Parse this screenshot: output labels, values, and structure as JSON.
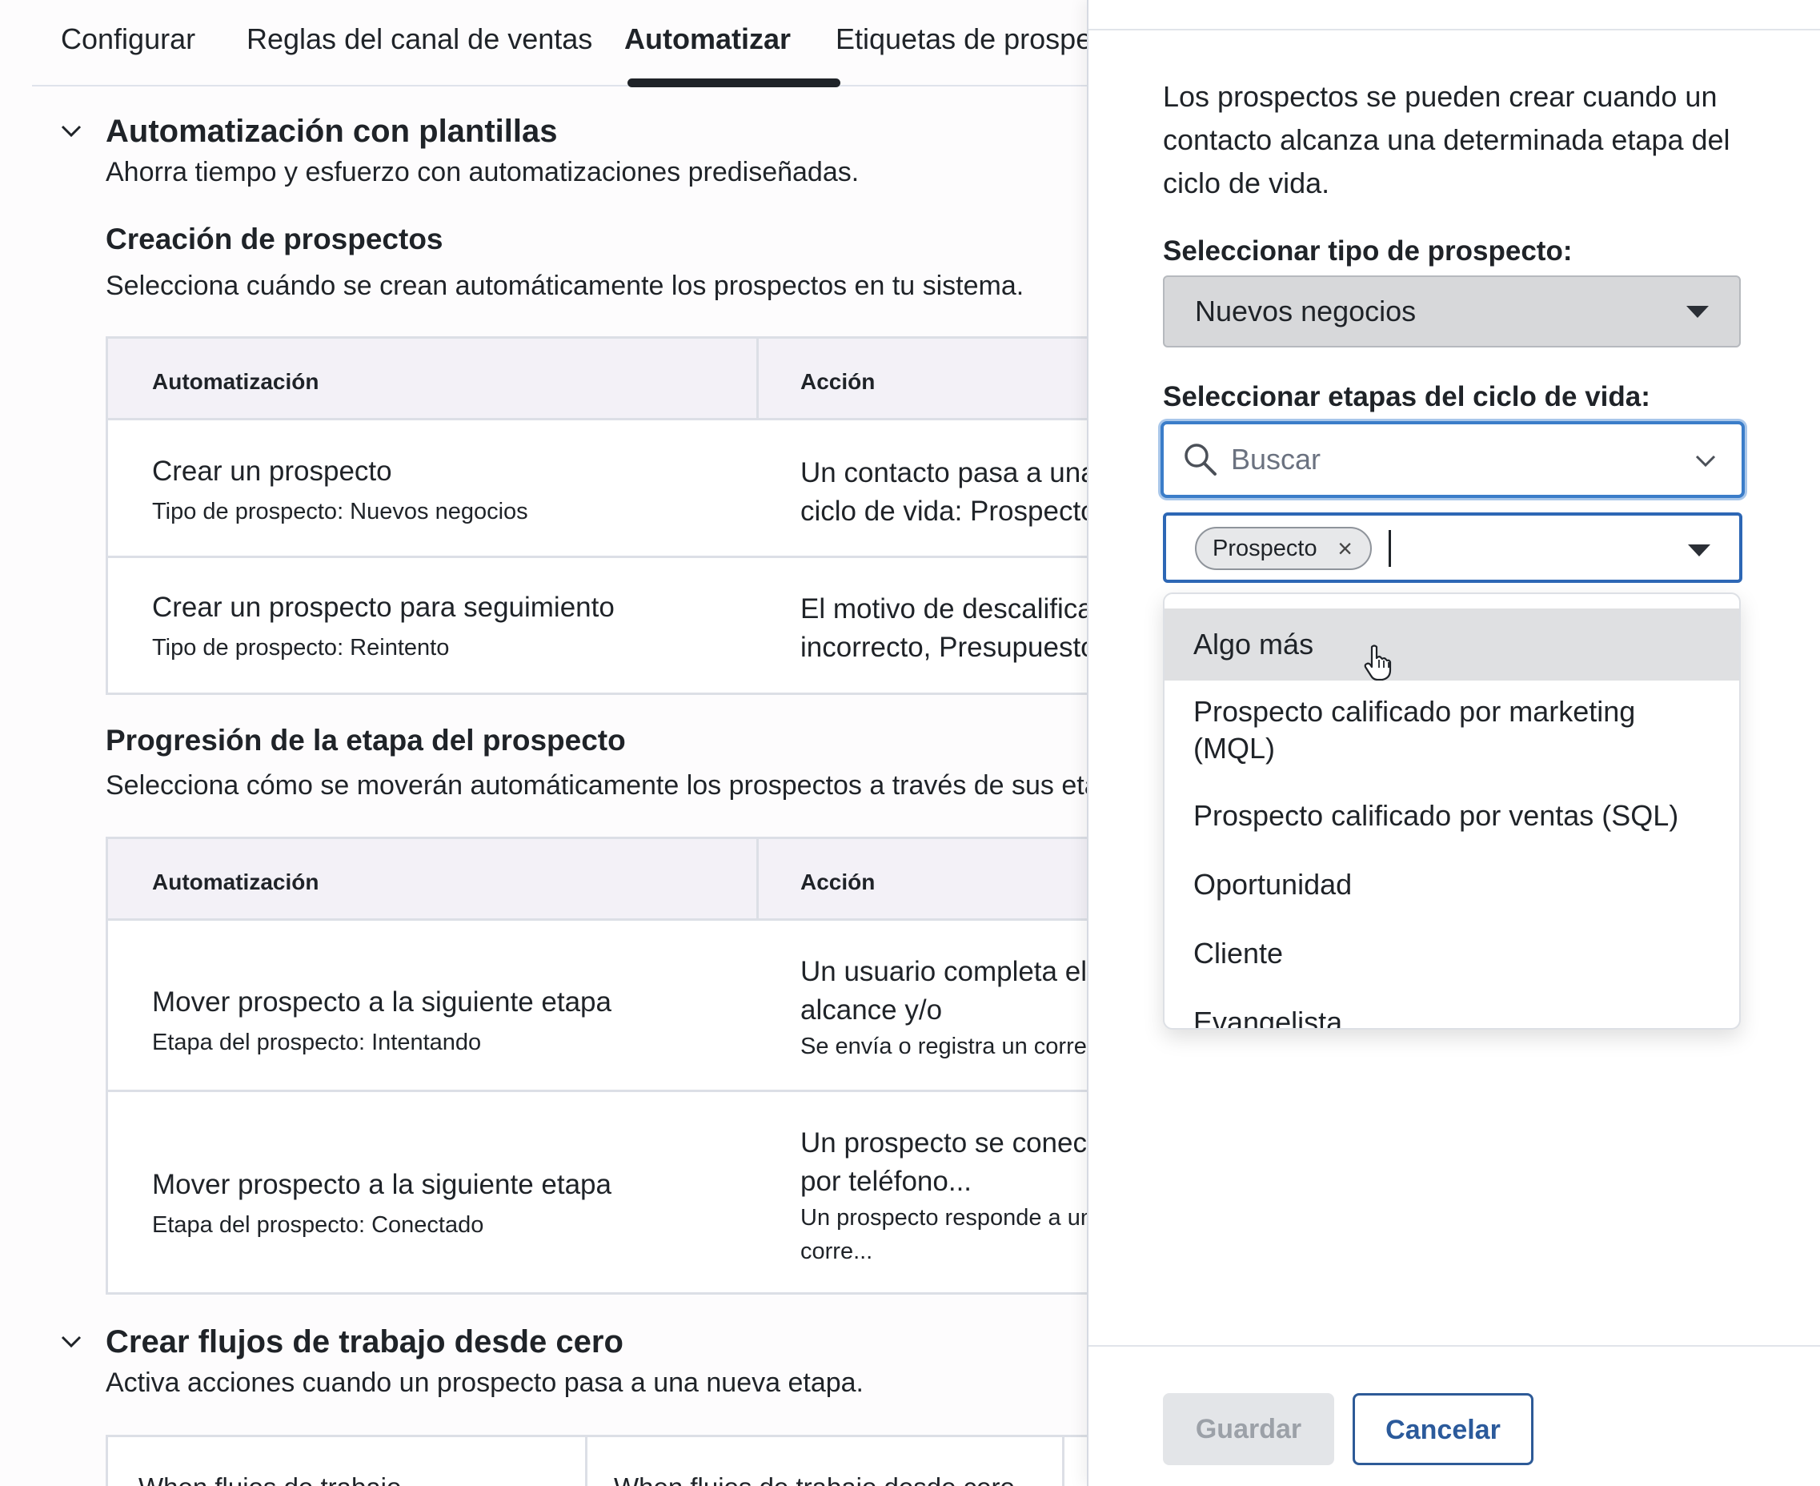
{
  "tabs": [
    {
      "label": "Configurar"
    },
    {
      "label": "Reglas del canal de ventas"
    },
    {
      "label": "Automatizar",
      "active": true
    },
    {
      "label": "Etiquetas de prospec"
    }
  ],
  "template_section": {
    "title": "Automatización con plantillas",
    "subtitle": "Ahorra tiempo y esfuerzo con automatizaciones prediseñadas."
  },
  "creation": {
    "title": "Creación de prospectos",
    "subtitle": "Selecciona cuándo se crean automáticamente los prospectos en tu sistema.",
    "headers": [
      "Automatización",
      "Acción"
    ],
    "rows": [
      {
        "main": "Crear un prospecto",
        "sub": "Tipo de prospecto: Nuevos negocios",
        "action1": "Un contacto pasa a una",
        "action2": "ciclo de vida: Prospecto"
      },
      {
        "main": "Crear un prospecto para seguimiento",
        "sub": "Tipo de prospecto: Reintento",
        "action1": "El motivo de descalifica",
        "action2": "incorrecto, Presupuesto li"
      }
    ]
  },
  "progression": {
    "title": "Progresión de la etapa del prospecto",
    "subtitle": "Selecciona cómo se moverán automáticamente los prospectos a través de sus eta",
    "headers": [
      "Automatización",
      "Acción"
    ],
    "rows": [
      {
        "main": "Mover prospecto a la siguiente etapa",
        "sub": "Etapa del prospecto: Intentando",
        "action1": "Un usuario completa el",
        "action2": "alcance y/o",
        "action3": "Se envía o registra un correo"
      },
      {
        "main": "Mover prospecto a la siguiente etapa",
        "sub": "Etapa del prospecto: Conectado",
        "action1": "Un prospecto se conect",
        "action2": "por teléfono...",
        "action3": "Un prospecto responde a un",
        "action4": "corre..."
      }
    ]
  },
  "scratch_section": {
    "title": "Crear flujos de trabajo desde cero",
    "subtitle": "Activa acciones cuando un prospecto pasa a una nueva etapa.",
    "col1": "When flujos de trabajo",
    "col2": "When flujos de trabajo desde cero"
  },
  "panel": {
    "description": "Los prospectos se pueden crear cuando un contacto alcanza una determinada etapa del ciclo de vida.",
    "type_label": "Seleccionar tipo de prospecto:",
    "type_value": "Nuevos negocios",
    "stages_label": "Seleccionar etapas del ciclo de vida:",
    "search_placeholder": "Buscar",
    "selected_chip": "Prospecto",
    "chip_remove": "×",
    "options": [
      "Algo más",
      "Prospecto calificado por marketing (MQL)",
      "Prospecto calificado por ventas (SQL)",
      "Oportunidad",
      "Cliente",
      "Evangelista"
    ],
    "hovered_option_index": 0,
    "save_label": "Guardar",
    "cancel_label": "Cancelar"
  },
  "colors": {
    "focus_blue": "#3b7dc9",
    "cancel_blue": "#2b5a9b",
    "table_header_bg": "#f3f1f7"
  }
}
